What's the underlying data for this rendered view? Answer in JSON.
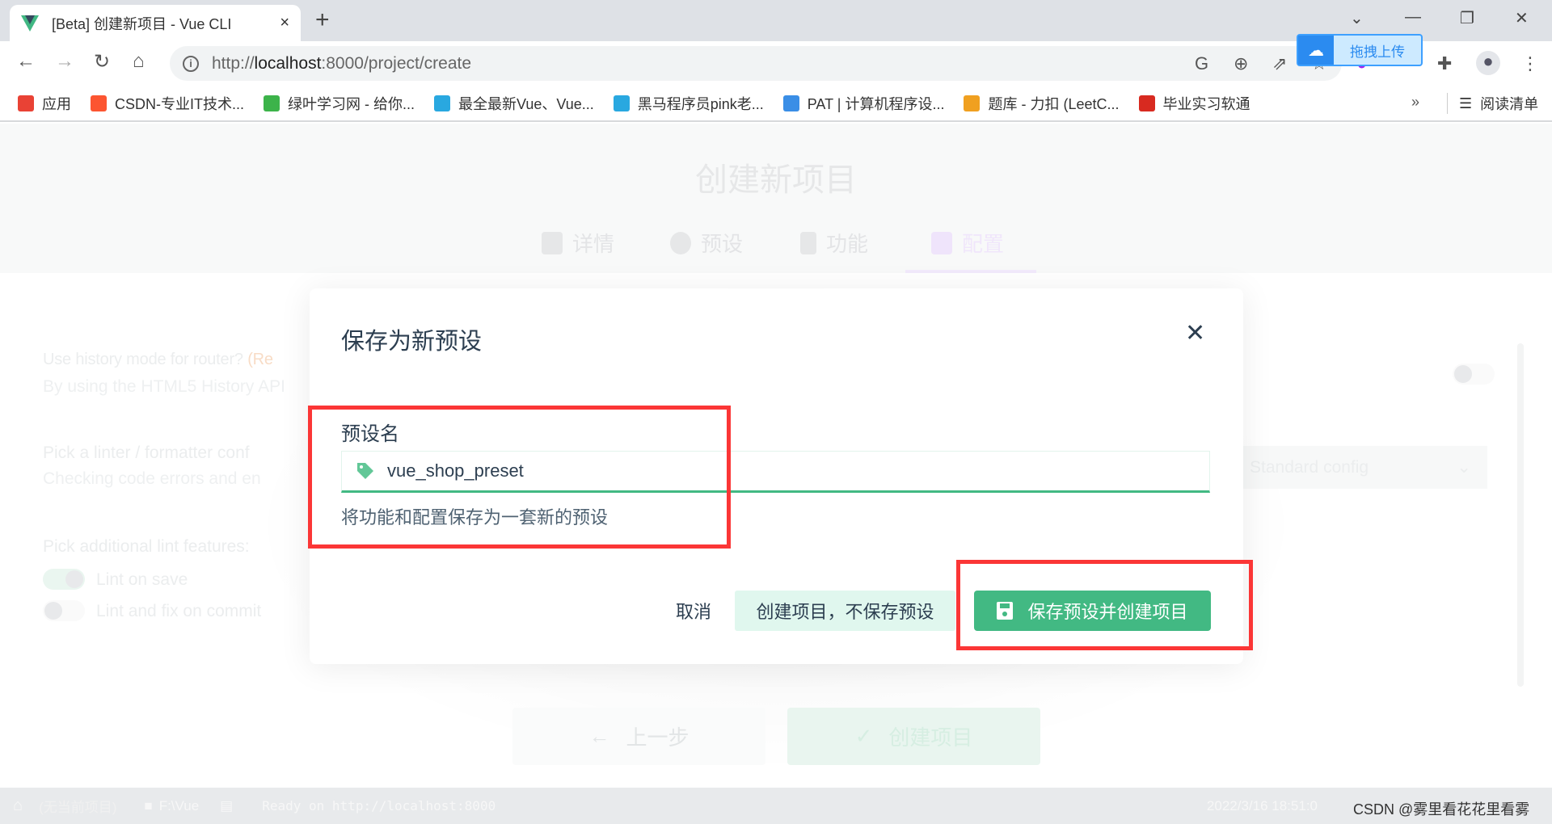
{
  "browser": {
    "tab_title": "[Beta] 创建新项目 - Vue CLI",
    "tab_close": "×",
    "new_tab": "+",
    "url_scheme": "http://",
    "url_host": "localhost",
    "url_rest": ":8000/project/create",
    "extension_popup_label": "拖拽上传",
    "bookmarks": [
      {
        "label": "应用",
        "color": "#e94235"
      },
      {
        "label": "CSDN-专业IT技术...",
        "color": "#fc5531"
      },
      {
        "label": "绿叶学习网 - 给你...",
        "color": "#3cb34a"
      },
      {
        "label": "最全最新Vue、Vue...",
        "color": "#29a8e0"
      },
      {
        "label": "黑马程序员pink老...",
        "color": "#29a8e0"
      },
      {
        "label": "PAT | 计算机程序设...",
        "color": "#3a8ee6"
      },
      {
        "label": "题库 - 力扣 (LeetC...",
        "color": "#f0a020"
      },
      {
        "label": "毕业实习软通",
        "color": "#d82a20"
      }
    ],
    "bookmarks_more": "»",
    "reading_list": "阅读清单"
  },
  "page": {
    "title": "创建新项目",
    "steps": [
      {
        "label": "详情",
        "icon": "list-icon"
      },
      {
        "label": "预设",
        "icon": "check-circle-icon"
      },
      {
        "label": "功能",
        "icon": "fork-icon"
      },
      {
        "label": "配置",
        "icon": "settings-icon",
        "active": true
      }
    ],
    "bg_options": {
      "router_title": "Use history mode for router?",
      "router_title_suffix": "(Re",
      "router_desc": "By using the HTML5 History API",
      "linter_title": "Pick a linter / formatter conf",
      "linter_desc": "Checking code errors and en",
      "linter_value": "Standard config",
      "lint_features_title": "Pick additional lint features:",
      "lint_on_save": "Lint on save",
      "lint_on_commit": "Lint and fix on commit"
    },
    "prev_button": "上一步",
    "create_button": "创建项目"
  },
  "modal": {
    "title": "保存为新预设",
    "close": "✕",
    "field_label": "预设名",
    "field_value": "vue_shop_preset",
    "field_hint": "将功能和配置保存为一套新的预设",
    "cancel_label": "取消",
    "create_without_save_label": "创建项目，不保存预设",
    "save_and_create_label": "保存预设并创建项目",
    "accent": "#42b983"
  },
  "statusbar": {
    "project": "(无当前项目)",
    "folder": "F:\\Vue",
    "log": "Ready on http://localhost:8000",
    "time": "2022/3/16 18:51:0"
  },
  "watermark": "CSDN @雾里看花花里看雾"
}
